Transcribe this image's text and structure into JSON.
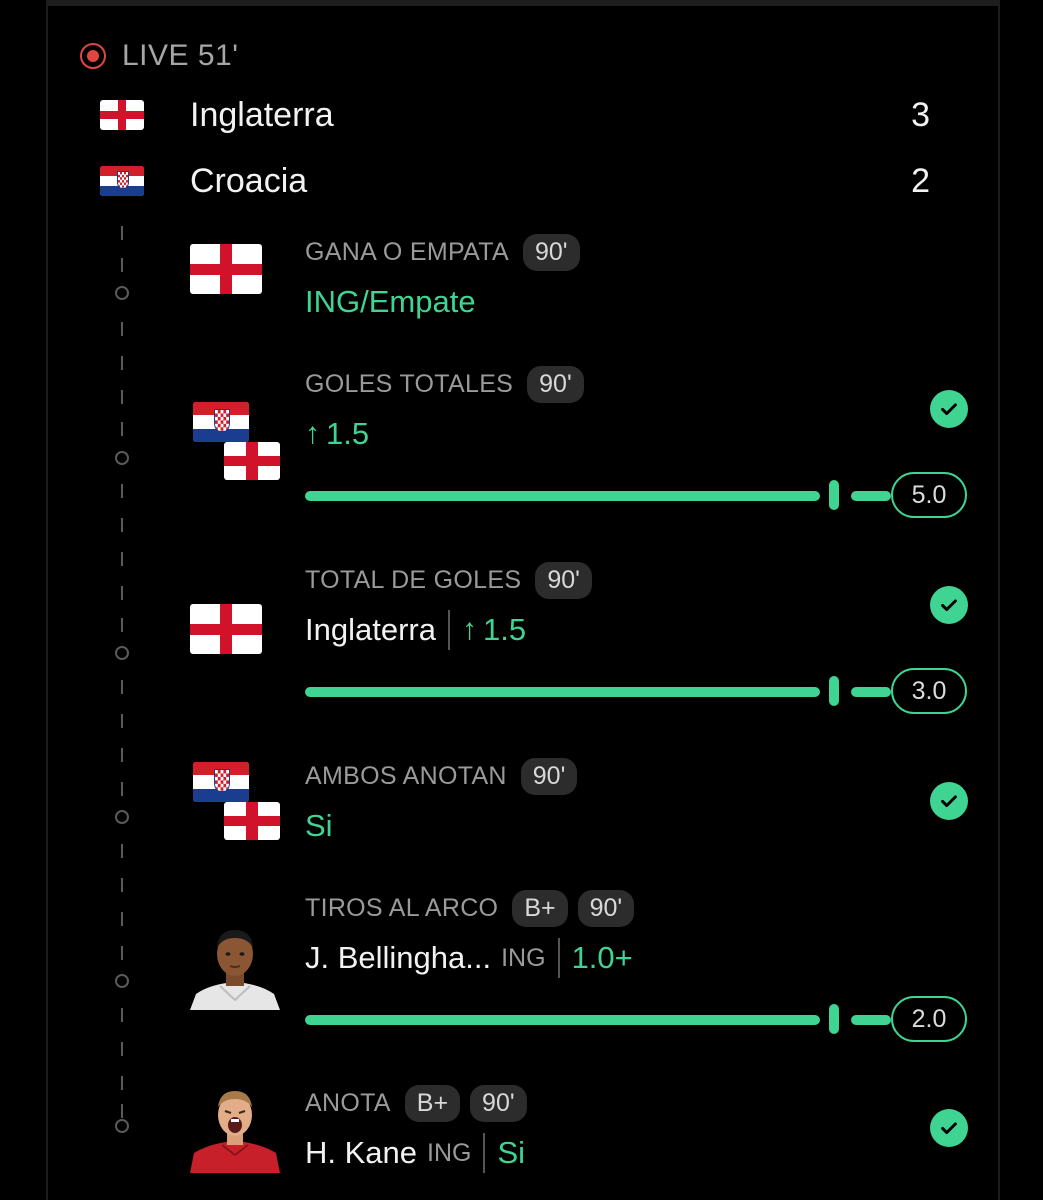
{
  "live": {
    "label": "LIVE 51'"
  },
  "teams": [
    {
      "name": "Inglaterra",
      "score": "3",
      "flag": "england-flag"
    },
    {
      "name": "Croacia",
      "score": "2",
      "flag": "croatia-flag"
    }
  ],
  "bets": [
    {
      "market": "GANA O EMPATA",
      "tags": [
        "90'"
      ],
      "selection": "ING/Empate",
      "icon": "england-flag",
      "settled": false
    },
    {
      "market": "GOLES TOTALES",
      "tags": [
        "90'"
      ],
      "selection": "1.5",
      "direction": "over",
      "icon": "croatia-england-flags",
      "settled": true,
      "progress_target": "5.0",
      "progress_fraction": 1
    },
    {
      "market": "TOTAL DE GOLES",
      "tags": [
        "90'"
      ],
      "subject": "Inglaterra",
      "selection": "1.5",
      "direction": "over",
      "icon": "england-flag",
      "settled": true,
      "progress_target": "3.0",
      "progress_fraction": 1
    },
    {
      "market": "AMBOS ANOTAN",
      "tags": [
        "90'"
      ],
      "selection": "Si",
      "icon": "croatia-england-flags",
      "settled": true
    },
    {
      "market": "TIROS AL ARCO",
      "tags": [
        "B+",
        "90'"
      ],
      "subject": "J. Bellingha...",
      "team": "ING",
      "selection": "1.0+",
      "icon": "player-avatar",
      "settled": false,
      "progress_target": "2.0",
      "progress_fraction": 1
    },
    {
      "market": "ANOTA",
      "tags": [
        "B+",
        "90'"
      ],
      "subject": "H. Kane",
      "team": "ING",
      "selection": "Si",
      "icon": "player-avatar",
      "settled": true
    }
  ],
  "colors": {
    "accent": "#3fd492",
    "live": "#e0463f",
    "background": "#000000",
    "pill": "#2c2c2c",
    "muted": "#9a9a9a"
  }
}
